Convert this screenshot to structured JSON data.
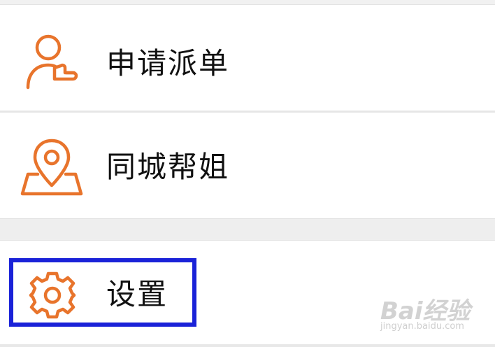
{
  "menu": {
    "items": [
      {
        "label": "申请派单",
        "icon": "user-pointing-icon"
      },
      {
        "label": "同城帮姐",
        "icon": "map-location-icon"
      },
      {
        "label": "设置",
        "icon": "gear-icon",
        "highlighted": true
      }
    ]
  },
  "colors": {
    "icon_orange": "#e8742c",
    "highlight_blue": "#1a22d8",
    "text": "#111111",
    "background": "#ffffff",
    "divider": "#e6e6e6"
  },
  "watermark": {
    "brand": "Bai经验",
    "url": "jingyan.baidu.com"
  }
}
